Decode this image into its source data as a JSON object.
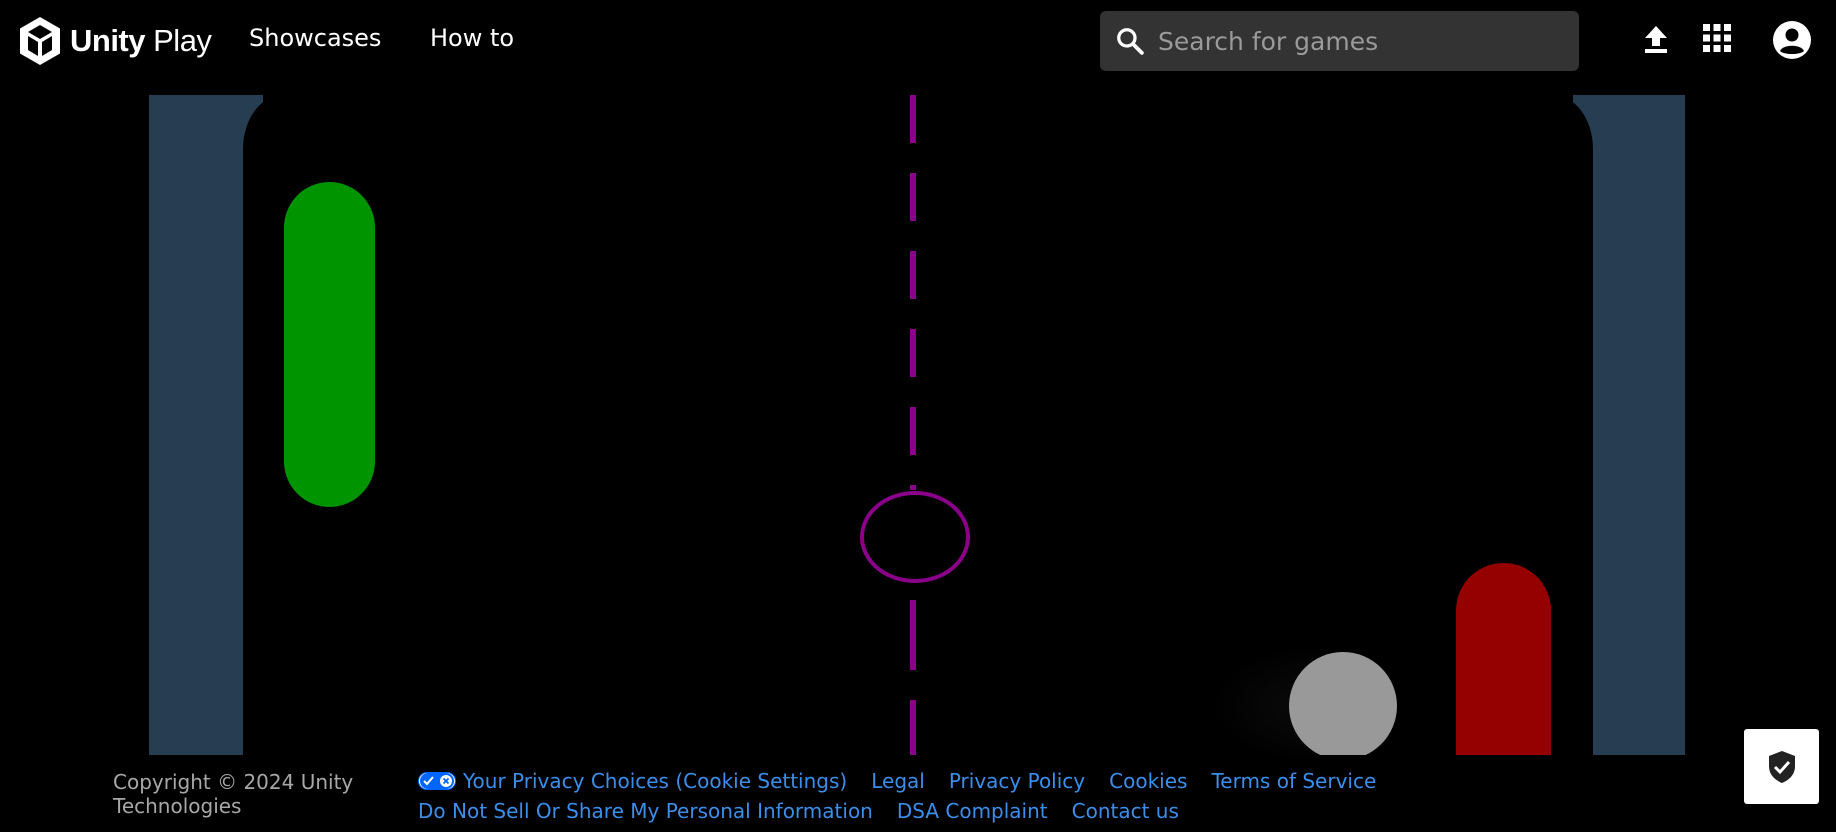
{
  "header": {
    "logo_bold": "Unity",
    "logo_light": "Play",
    "nav": {
      "showcases": "Showcases",
      "how_to": "How to"
    },
    "search": {
      "placeholder": "Search for games"
    },
    "icons": [
      "search-icon",
      "upload-icon",
      "apps-grid-icon",
      "account-circle-icon"
    ]
  },
  "game": {
    "description_colors": {
      "walls": "#263d52",
      "left_paddle": "#009400",
      "right_paddle": "#950000",
      "ball": "#999999",
      "center_line": "#8a008a"
    }
  },
  "footer": {
    "copyright": "Copyright © 2024 Unity Technologies",
    "links_row1": {
      "privacy_choices": "Your Privacy Choices (Cookie Settings)",
      "legal": "Legal",
      "privacy_policy": "Privacy Policy",
      "cookies": "Cookies",
      "terms": "Terms of Service"
    },
    "links_row2": {
      "do_not_sell": "Do Not Sell Or Share My Personal Information",
      "dsa_complaint": "DSA Complaint",
      "contact_us": "Contact us"
    },
    "link_color": "#3b8eea"
  }
}
